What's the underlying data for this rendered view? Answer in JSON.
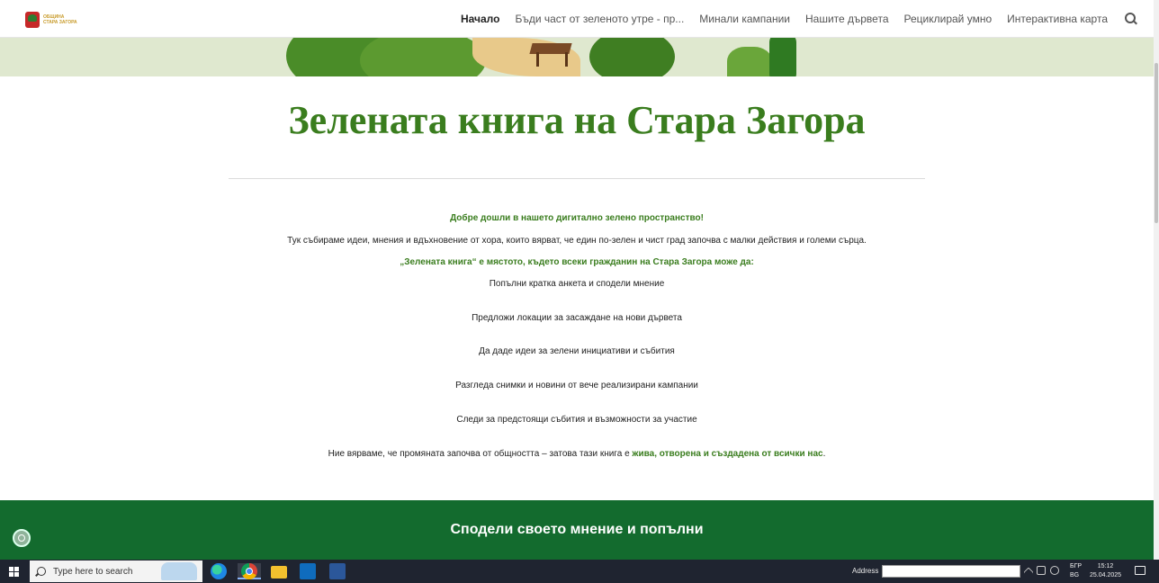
{
  "header": {
    "logo_text": "ОБЩИНА СТАРА ЗАГОРА",
    "nav": [
      {
        "label": "Начало",
        "active": true
      },
      {
        "label": "Бъди част от зеленото утре - пр..."
      },
      {
        "label": "Минали кампании"
      },
      {
        "label": "Нашите дървета"
      },
      {
        "label": "Рециклирай умно"
      },
      {
        "label": "Интерактивна карта"
      }
    ]
  },
  "main": {
    "title": "Зелената книга на Стара Загора",
    "welcome": "Добре дошли в нашето дигитално зелено пространство!",
    "intro": "Тук събираме идеи, мнения и вдъхновение от хора, които вярват, че един по-зелен и чист град започва с малки действия и големи сърца.",
    "lead": "„Зелената книга“ е мястото, където всеки гражданин на Стара Загора може да:",
    "items": [
      "Попълни кратка анкета и сподели мнение",
      "Предложи локации за засаждане на нови дървета",
      "Да даде идеи за зелени инициативи и събития",
      "Разгледа снимки и новини от вече реализирани кампании",
      "Следи за предстоящи събития и възможности за участие"
    ],
    "closing_pre": "Ние вярваме, че промяната започва от общността – затова тази книга е ",
    "closing_hl": "жива, отворена и създадена от всички нас",
    "closing_post": "."
  },
  "green_section": {
    "title": "Сподели своето мнение и попълни"
  },
  "taskbar": {
    "search_placeholder": "Type here to search",
    "address_label": "Address",
    "lang_top": "БГР",
    "lang_bottom": "BG",
    "time": "15:12",
    "date": "25.04.2025"
  },
  "colors": {
    "accent_green": "#3a7d1e",
    "section_green": "#136b2e",
    "banner_bg": "#dfe8cf"
  }
}
